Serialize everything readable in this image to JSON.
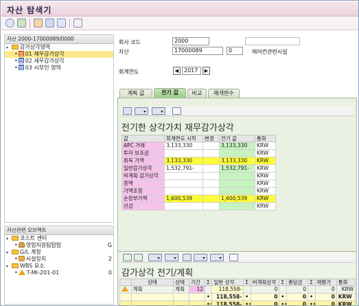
{
  "title": "자산 탐색기",
  "tree": {
    "header": "자산 2000-17000089/0000",
    "root": "감가상각영역",
    "items": [
      {
        "label": "01 재무감가상각"
      },
      {
        "label": "02 세무감가상각"
      },
      {
        "label": "03 시부인 영역"
      }
    ]
  },
  "objects": {
    "header": "자산관련 오브젝트",
    "groups": [
      {
        "label": "코스트 센터",
        "child": "영업지원팀탑탑",
        "child_value": "G"
      },
      {
        "label": "G/L 계정",
        "child": "시설장치",
        "child_value": "2"
      },
      {
        "label": "WBS 요소",
        "child": "T-MI-201-01",
        "child_value": "0"
      }
    ]
  },
  "form": {
    "company_code_label": "회사 코드",
    "company_code": "2000",
    "asset_label": "자산",
    "asset_no": "17000089",
    "asset_sub": "0",
    "asset_desc": "에어컨관련시설",
    "fiscal_year_label": "회계연도",
    "fiscal_year": "2017"
  },
  "tabs": [
    "계획 값",
    "전기 값",
    "비교",
    "매개변수"
  ],
  "active_tab": 1,
  "posted": {
    "title": "전기한 상각가치 재무감가상각",
    "columns": [
      "값",
      "회계연도 시작",
      "변경",
      "전기 값",
      "통화"
    ],
    "rows": [
      {
        "label": "APC 거래",
        "start": "3,133,330",
        "change": "",
        "posted": "3,133,330",
        "cur": "KRW",
        "hl": false
      },
      {
        "label": "투자 보조금",
        "start": "",
        "change": "",
        "posted": "",
        "cur": "KRW",
        "hl": false
      },
      {
        "label": "취득 가액",
        "start": "3,133,330",
        "change": "",
        "posted": "3,133,330",
        "cur": "KRW",
        "hl": true
      },
      {
        "label": "일반감가상각",
        "start": "1,532,791-",
        "change": "",
        "posted": "1,532,791-",
        "cur": "KRW",
        "hl": false
      },
      {
        "label": "비계획 감가상각",
        "start": "",
        "change": "",
        "posted": "",
        "cur": "KRW",
        "hl": false
      },
      {
        "label": "증액",
        "start": "",
        "change": "",
        "posted": "",
        "cur": "KRW",
        "hl": false
      },
      {
        "label": "가액조정",
        "start": "",
        "change": "",
        "posted": "",
        "cur": "KRW",
        "hl": false
      },
      {
        "label": "순장부가액",
        "start": "1,600,539",
        "change": "",
        "posted": "1,600,539",
        "cur": "KRW",
        "hl": true
      },
      {
        "label": "선금",
        "start": "",
        "change": "",
        "posted": "",
        "cur": "KRW",
        "hl": false
      }
    ]
  },
  "plan": {
    "title": "감가상각 전기/계획",
    "columns": [
      "상태",
      "상태",
      "기간",
      "Σ",
      "일반 상각",
      "Σ",
      "비계획상각",
      "Σ",
      "총당금",
      "Σ",
      "재평가",
      "통화"
    ],
    "rows": [
      [
        "",
        "계획",
        "계획",
        "12",
        "",
        "118,558-",
        "",
        "0",
        "",
        "0",
        "",
        "0",
        "KRW"
      ],
      [
        "",
        "",
        "",
        "",
        "•",
        "118,558-",
        "•",
        "0",
        "•",
        "0",
        "•",
        "0",
        "KRW"
      ],
      [
        "",
        "",
        "",
        "",
        "••",
        "118,558-",
        "••",
        "0",
        "••",
        "0",
        "••",
        "0",
        "KRW"
      ]
    ]
  },
  "colors": {
    "title_bg": "#ead1dc",
    "label_cell": "#f5c2ea",
    "highlight_row": "#fdfc3a",
    "posted_col": "#c6f2c0",
    "active_tab": "#9ccd86"
  }
}
